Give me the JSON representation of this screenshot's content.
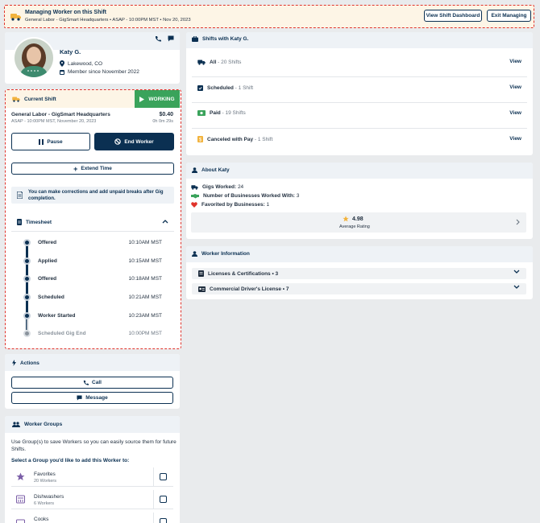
{
  "banner": {
    "title": "Managing Worker on this Shift",
    "subtitle": "General Labor - GigSmart Headquarters • ASAP - 10:00PM MST • Nov 20, 2023",
    "view_dashboard_label": "View Shift Dashboard",
    "exit_label": "Exit Managing"
  },
  "profile": {
    "name": "Katy G.",
    "location": "Lakewood, CO",
    "member_since": "Member since November 2022"
  },
  "current_shift": {
    "header": "Current Shift",
    "status": "WORKING",
    "title": "General Labor - GigSmart Headquarters",
    "subtitle": "ASAP - 10:00PM MST, November 20, 2023",
    "pay": "$0.40",
    "duration": "0h 0m 29s",
    "pause_label": "Pause",
    "end_label": "End Worker",
    "extend_label": "Extend Time",
    "info_text": "You can make corrections and add unpaid breaks after Gig completion.",
    "timesheet_label": "Timesheet",
    "timesheet": [
      {
        "label": "Offered",
        "time": "10:10AM MST"
      },
      {
        "label": "Applied",
        "time": "10:15AM MST"
      },
      {
        "label": "Offered",
        "time": "10:18AM MST"
      },
      {
        "label": "Scheduled",
        "time": "10:21AM MST"
      },
      {
        "label": "Worker Started",
        "time": "10:23AM MST"
      },
      {
        "label": "Scheduled Gig End",
        "time": "10:00PM MST"
      }
    ]
  },
  "actions": {
    "header": "Actions",
    "call_label": "Call",
    "message_label": "Message"
  },
  "worker_groups": {
    "header": "Worker Groups",
    "description": "Use Group(s) to save Workers so you can easily source them for future Shifts.",
    "select_prompt": "Select a Group you'd like to add this Worker to:",
    "groups": [
      {
        "name": "Favorites",
        "count": "20 Workers"
      },
      {
        "name": "Dishwashers",
        "count": "6 Workers"
      },
      {
        "name": "Cooks",
        "count": ""
      }
    ]
  },
  "shifts": {
    "header": "Shifts with Katy G.",
    "view_label": "View",
    "rows": [
      {
        "label": "All",
        "count": " - 20 Shifts",
        "icon_color": "#0b3052"
      },
      {
        "label": "Scheduled",
        "count": " - 1 Shift",
        "icon_color": "#0b3052"
      },
      {
        "label": "Paid",
        "count": " - 19 Shifts",
        "icon_color": "#3aa35b"
      },
      {
        "label": "Canceled with Pay",
        "count": " - 1 Shift",
        "icon_color": "#f2b33d"
      }
    ]
  },
  "about": {
    "header": "About Katy",
    "gigs_label": "Gigs Worked:",
    "gigs_value": " 24",
    "businesses_label": "Number of Businesses Worked With:",
    "businesses_value": " 3",
    "favorited_label": "Favorited by Businesses:",
    "favorited_value": " 1",
    "rating": "4.98",
    "rating_label": "Average Rating"
  },
  "worker_info": {
    "header": "Worker Information",
    "licenses": "Licenses & Certifications • 3",
    "cdl": "Commercial Driver's License • 7"
  },
  "colors": {
    "navy": "#0b3052",
    "working_green": "#3aa35b",
    "banner_bg": "#fdf5e6",
    "accent_orange": "#f2b33d",
    "dashed_red": "#e0332b"
  }
}
